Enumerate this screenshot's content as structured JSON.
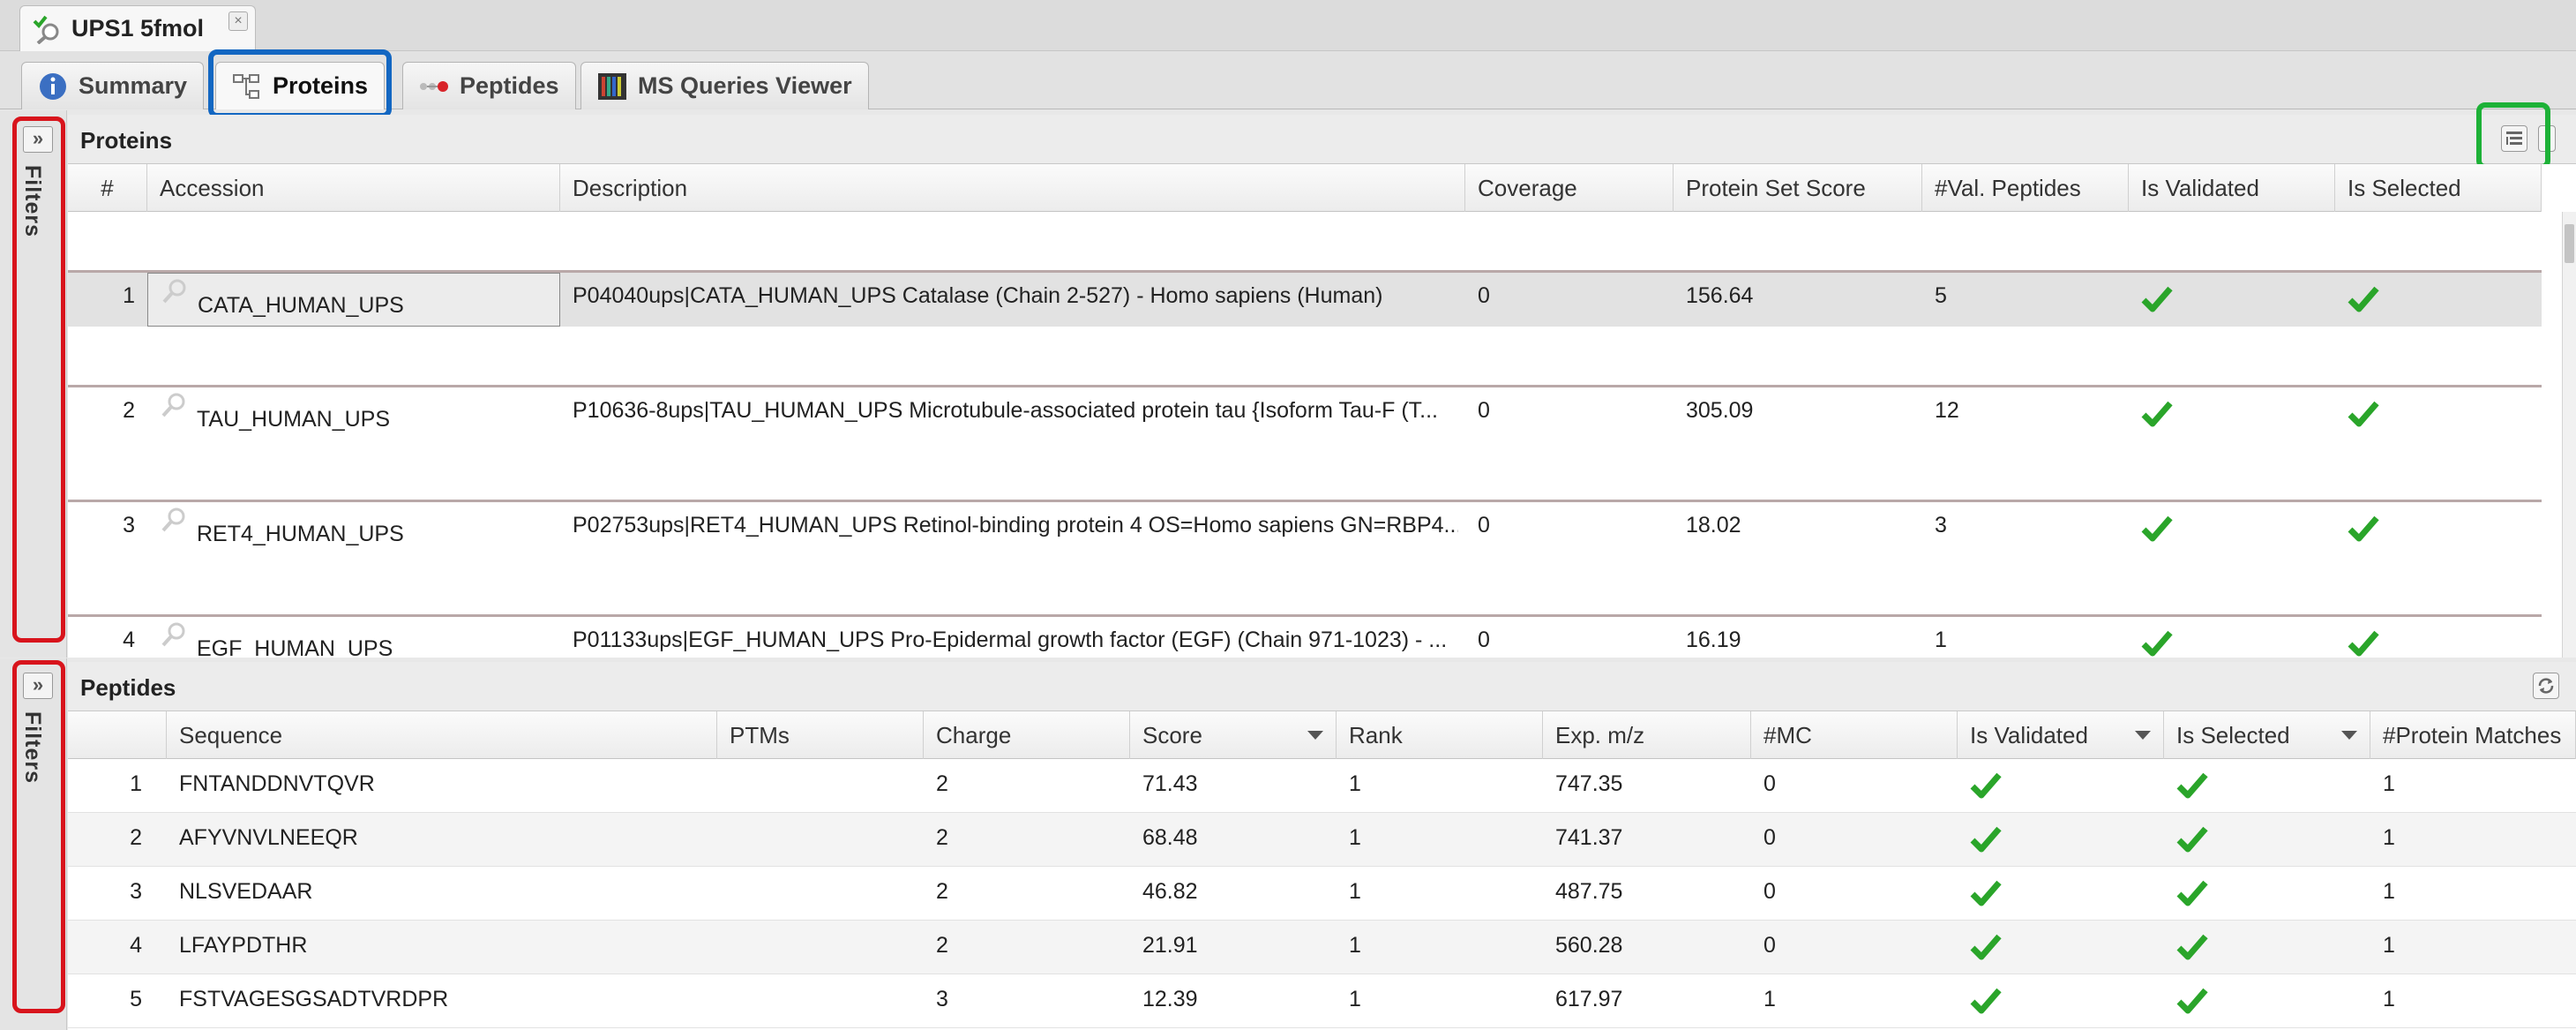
{
  "document_tab": {
    "title": "UPS1 5fmol",
    "close_glyph": "×",
    "icon": "magnifier-check-icon"
  },
  "view_tabs": [
    {
      "label": "Summary",
      "icon": "info-icon",
      "active": false
    },
    {
      "label": "Proteins",
      "icon": "tree-icon",
      "active": true
    },
    {
      "label": "Peptides",
      "icon": "peptide-icon",
      "active": false
    },
    {
      "label": "MS Queries Viewer",
      "icon": "spectrum-icon",
      "active": false
    }
  ],
  "filters": {
    "label": "Filters",
    "expand_glyph": "»"
  },
  "proteins_panel": {
    "title": "Proteins",
    "columns": [
      "#",
      "Accession",
      "Description",
      "Coverage",
      "Protein Set Score",
      "#Val. Peptides",
      "Is Validated",
      "Is Selected"
    ],
    "rows": [
      {
        "num": "1",
        "accession": "CATA_HUMAN_UPS",
        "description": "P04040ups|CATA_HUMAN_UPS Catalase (Chain 2-527) - Homo sapiens (Human)",
        "coverage": "0",
        "score": "156.64",
        "val_peptides": "5",
        "is_validated": true,
        "is_selected": true
      },
      {
        "num": "2",
        "accession": "TAU_HUMAN_UPS",
        "description": "P10636-8ups|TAU_HUMAN_UPS Microtubule-associated protein tau {Isoform Tau-F (T...",
        "coverage": "0",
        "score": "305.09",
        "val_peptides": "12",
        "is_validated": true,
        "is_selected": true
      },
      {
        "num": "3",
        "accession": "RET4_HUMAN_UPS",
        "description": "P02753ups|RET4_HUMAN_UPS Retinol-binding protein 4 OS=Homo sapiens GN=RBP4...",
        "coverage": "0",
        "score": "18.02",
        "val_peptides": "3",
        "is_validated": true,
        "is_selected": true
      },
      {
        "num": "4",
        "accession": "EGF_HUMAN_UPS",
        "description": "P01133ups|EGF_HUMAN_UPS Pro-Epidermal growth factor (EGF) (Chain 971-1023) - ...",
        "coverage": "0",
        "score": "16.19",
        "val_peptides": "1",
        "is_validated": true,
        "is_selected": true
      }
    ]
  },
  "peptides_panel": {
    "title": "Peptides",
    "columns": [
      "",
      "Sequence",
      "PTMs",
      "Charge",
      "Score",
      "Rank",
      "Exp. m/z",
      "#MC",
      "Is Validated",
      "Is Selected",
      "#Protein Matches"
    ],
    "rows": [
      {
        "num": "1",
        "sequence": "FNTANDDNVTQVR",
        "ptms": "",
        "charge": "2",
        "score": "71.43",
        "rank": "1",
        "mz": "747.35",
        "mc": "0",
        "is_validated": true,
        "is_selected": true,
        "protein_matches": "1"
      },
      {
        "num": "2",
        "sequence": "AFYVNVLNEEQR",
        "ptms": "",
        "charge": "2",
        "score": "68.48",
        "rank": "1",
        "mz": "741.37",
        "mc": "0",
        "is_validated": true,
        "is_selected": true,
        "protein_matches": "1"
      },
      {
        "num": "3",
        "sequence": "NLSVEDAAR",
        "ptms": "",
        "charge": "2",
        "score": "46.82",
        "rank": "1",
        "mz": "487.75",
        "mc": "0",
        "is_validated": true,
        "is_selected": true,
        "protein_matches": "1"
      },
      {
        "num": "4",
        "sequence": "LFAYPDTHR",
        "ptms": "",
        "charge": "2",
        "score": "21.91",
        "rank": "1",
        "mz": "560.28",
        "mc": "0",
        "is_validated": true,
        "is_selected": true,
        "protein_matches": "1"
      },
      {
        "num": "5",
        "sequence": "FSTVAGESGSADTVRDPR",
        "ptms": "",
        "charge": "3",
        "score": "12.39",
        "rank": "1",
        "mz": "617.97",
        "mc": "1",
        "is_validated": true,
        "is_selected": true,
        "protein_matches": "1"
      }
    ]
  },
  "colors": {
    "highlight_blue": "#1367c2",
    "highlight_red": "#d8141c",
    "highlight_green": "#1db137",
    "check_green": "#2aa52a"
  }
}
